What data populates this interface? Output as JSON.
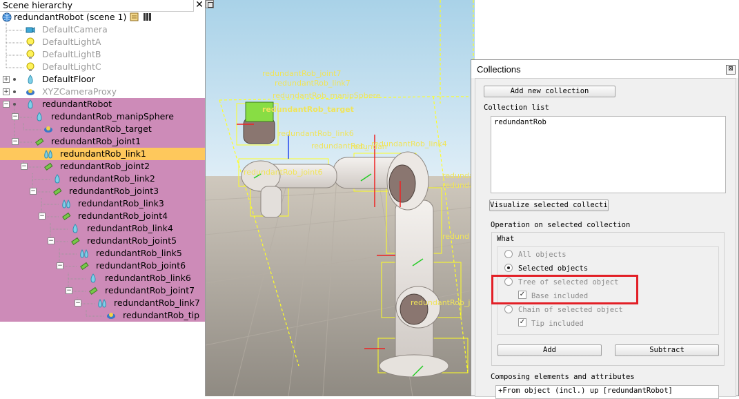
{
  "hierarchy": {
    "title": "Scene hierarchy",
    "close_glyph": "✕",
    "scene_label": "redundantRobot (scene 1)",
    "items": [
      {
        "label": "DefaultCamera",
        "icon": "camera-icon"
      },
      {
        "label": "DefaultLightA",
        "icon": "light-icon"
      },
      {
        "label": "DefaultLightB",
        "icon": "light-icon"
      },
      {
        "label": "DefaultLightC",
        "icon": "light-icon"
      },
      {
        "label": "DefaultFloor",
        "icon": "shape-icon"
      },
      {
        "label": "XYZCameraProxy",
        "icon": "dummy-icon"
      },
      {
        "label": "redundantRobot",
        "icon": "shape-icon"
      },
      {
        "label": "redundantRob_manipSphere",
        "icon": "shape-icon"
      },
      {
        "label": "redundantRob_target",
        "icon": "dummy-icon"
      },
      {
        "label": "redundantRob_joint1",
        "icon": "joint-icon"
      },
      {
        "label": "redundantRob_link1",
        "icon": "link-shape-icon"
      },
      {
        "label": "redundantRob_joint2",
        "icon": "joint-icon"
      },
      {
        "label": "redundantRob_link2",
        "icon": "shape-icon"
      },
      {
        "label": "redundantRob_joint3",
        "icon": "joint-icon"
      },
      {
        "label": "redundantRob_link3",
        "icon": "link-shape-icon"
      },
      {
        "label": "redundantRob_joint4",
        "icon": "joint-icon"
      },
      {
        "label": "redundantRob_link4",
        "icon": "shape-icon"
      },
      {
        "label": "redundantRob_joint5",
        "icon": "joint-icon"
      },
      {
        "label": "redundantRob_link5",
        "icon": "link-shape-icon"
      },
      {
        "label": "redundantRob_joint6",
        "icon": "joint-icon"
      },
      {
        "label": "redundantRob_link6",
        "icon": "shape-icon"
      },
      {
        "label": "redundantRob_joint7",
        "icon": "joint-icon"
      },
      {
        "label": "redundantRob_link7",
        "icon": "link-shape-icon"
      },
      {
        "label": "redundantRob_tip",
        "icon": "dummy-icon"
      }
    ],
    "selected_item": "redundantRob_link1",
    "highlight_color": "#cd8bb8",
    "selection_color": "#fec85c"
  },
  "viewport": {
    "labels": {
      "joint7": "redundantRob_joint7",
      "link7": "redundantRob_link7",
      "manip": "redundantRob_manipSphere",
      "target": "redundantRob_target",
      "link6": "redundantRob_link6",
      "joint6": "redundantRob_joint6",
      "overlap1": "redundantRob_",
      "overlap2": "redundan",
      "overlap3": "redundantRob_link4",
      "joint_r": "redundantRob_joint",
      "link_r": "redundantRob_link",
      "redund": "redund",
      "joint2": "redundantRob_joint2"
    }
  },
  "collections": {
    "title": "Collections",
    "close_glyph": "⊠",
    "add_button": "Add new collection",
    "list_label": "Collection list",
    "list_items": [
      "redundantRob"
    ],
    "visualize_button": "Visualize selected collection",
    "operation_label": "Operation on selected collection",
    "what_label": "What",
    "options": {
      "all_objects": "All objects",
      "selected_objects": "Selected objects",
      "tree_of_selected": "Tree of selected object",
      "base_included": "Base included",
      "chain_of_selected": "Chain of selected object",
      "tip_included": "Tip included"
    },
    "selected_option": "selected_objects",
    "base_included_checked": true,
    "tip_included_checked": true,
    "add_btn": "Add",
    "subtract_btn": "Subtract",
    "composing_label": "Composing elements and attributes",
    "composing_items": [
      "+From object (incl.) up [redundantRobot]"
    ],
    "check_glyph": "✓",
    "annotation_color": "#e21f26"
  }
}
